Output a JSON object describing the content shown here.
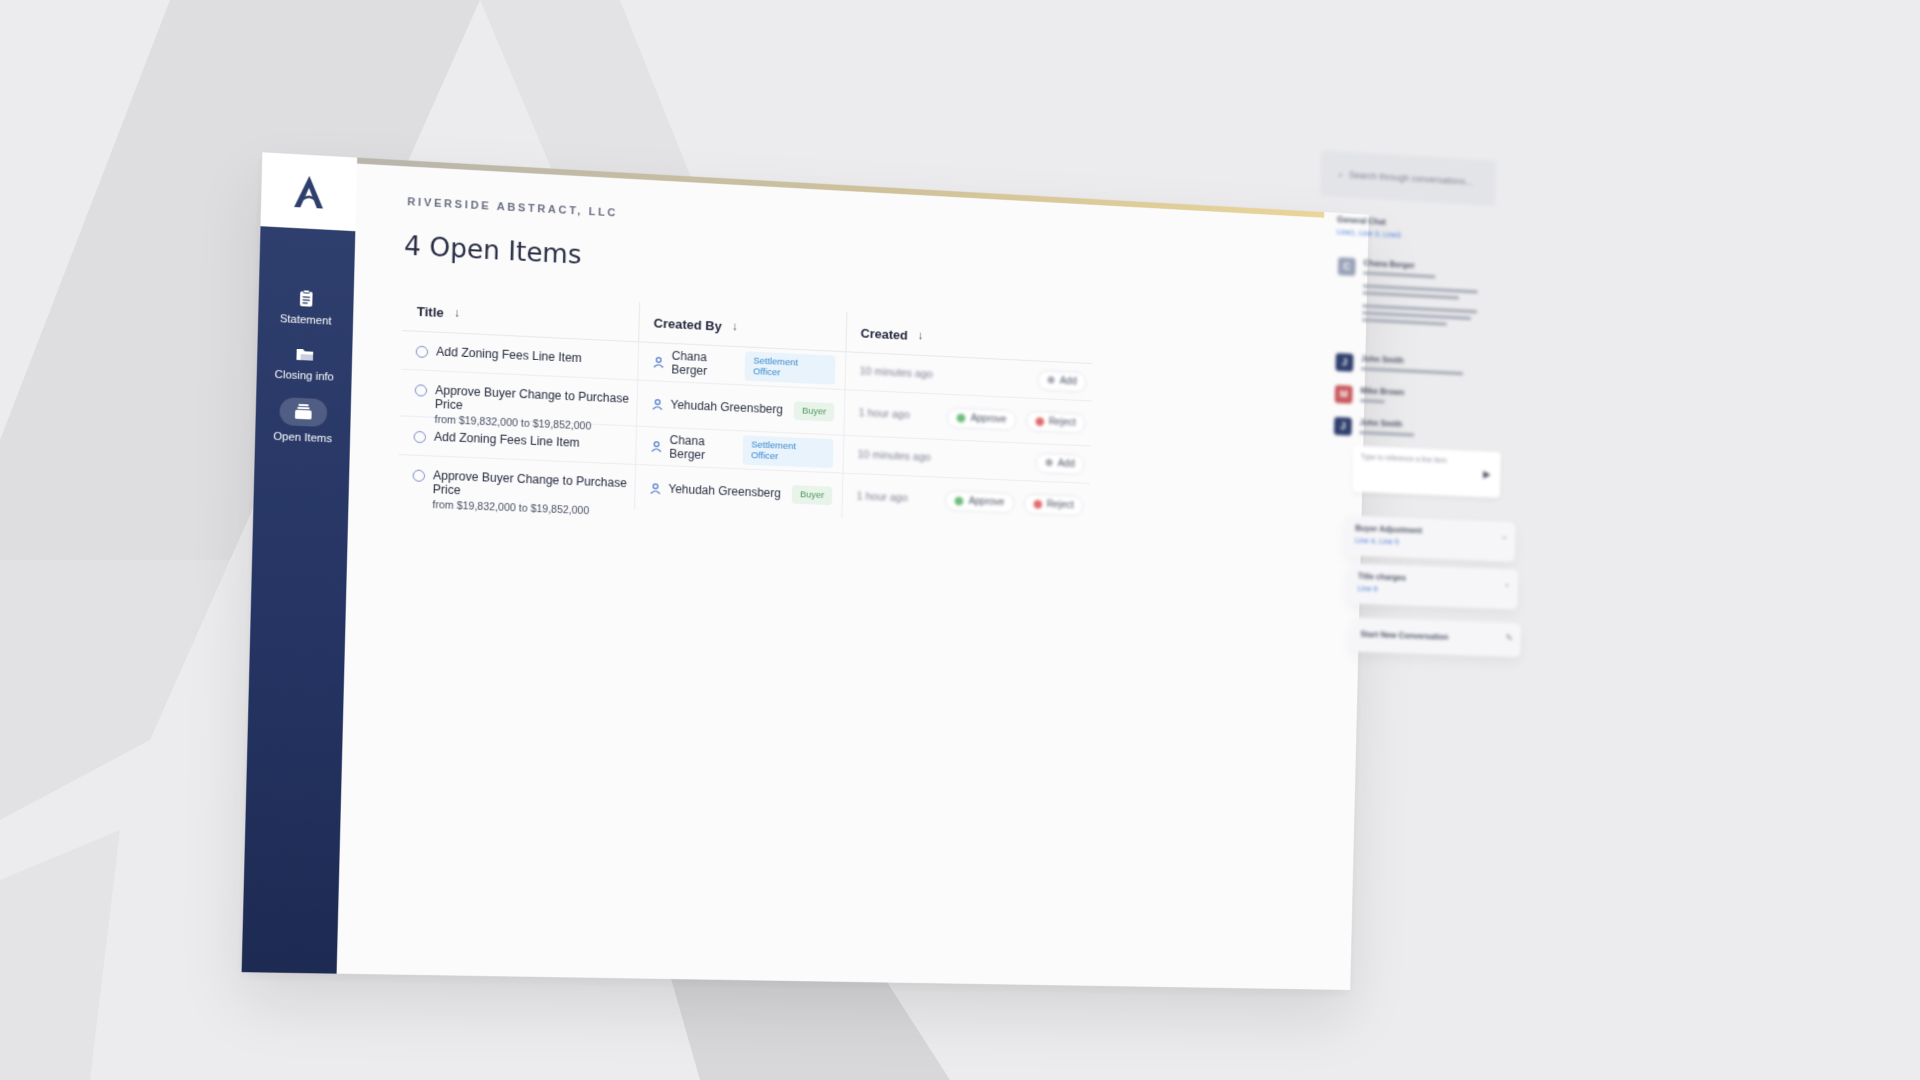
{
  "app": {
    "company": "RIVERSIDE ABSTRACT, LLC",
    "page_title": "4 Open Items"
  },
  "sidebar": {
    "items": [
      {
        "label": "Statement",
        "icon": "clipboard-icon"
      },
      {
        "label": "Closing info",
        "icon": "folder-icon"
      },
      {
        "label": "Open Items",
        "icon": "inbox-icon",
        "active": true
      }
    ]
  },
  "table": {
    "headers": {
      "title": "Title",
      "created_by": "Created By",
      "created": "Created",
      "sort_glyph": "↓"
    },
    "rows": [
      {
        "title": "Add Zoning Fees Line Item",
        "subtitle": "",
        "creator": "Chana Berger",
        "role": "Settlement Officer",
        "role_kind": "officer",
        "time": "10 minutes ago",
        "actions": [
          "Add"
        ]
      },
      {
        "title": "Approve Buyer Change to Purchase Price",
        "subtitle": "from $19,832,000 to $19,852,000",
        "creator": "Yehudah Greensberg",
        "role": "Buyer",
        "role_kind": "buyer",
        "time": "1 hour ago",
        "actions": [
          "Approve",
          "Reject"
        ]
      },
      {
        "title": "Add Zoning Fees Line Item",
        "subtitle": "",
        "creator": "Chana Berger",
        "role": "Settlement Officer",
        "role_kind": "officer",
        "time": "10 minutes ago",
        "actions": [
          "Add"
        ]
      },
      {
        "title": "Approve Buyer Change to Purchase Price",
        "subtitle": "from $19,832,000 to $19,852,000",
        "creator": "Yehudah Greensberg",
        "role": "Buyer",
        "role_kind": "buyer",
        "time": "1 hour ago",
        "actions": [
          "Approve",
          "Reject"
        ]
      }
    ]
  },
  "conversation": {
    "search_placeholder": "Search through conversations...",
    "threads": [
      {
        "title": "General Chat",
        "links": "Line1, Line 3, Line3"
      },
      {
        "title": "Buyer Adjustment",
        "links": "Line 4, Line 5"
      },
      {
        "title": "Title charges",
        "links": "Line 6"
      }
    ],
    "messages": [
      {
        "author": "Chana Berger",
        "initial": "C",
        "color": "#9aa3b8"
      },
      {
        "author": "John Smith",
        "initial": "J",
        "color": "#2f3f6d"
      },
      {
        "author": "Mike Brown",
        "initial": "M",
        "color": "#c8585c"
      },
      {
        "author": "John Smith",
        "initial": "J",
        "color": "#2f3f6d"
      }
    ],
    "reply_placeholder": "Type to reference a line item",
    "new_conversation": "Start New Conversation"
  },
  "colors": {
    "sidebar": "#253463",
    "accent_gold": "#ead59a",
    "officer_badge": "#3b8ad0",
    "buyer_badge": "#4e9a5b"
  }
}
